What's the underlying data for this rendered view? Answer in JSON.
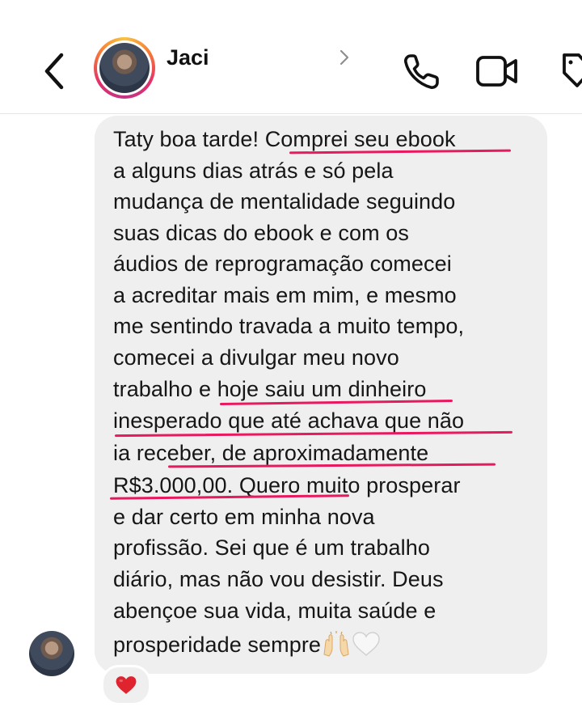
{
  "header": {
    "contact_name": "Jaci",
    "back_icon": "chevron-left-icon",
    "call_icon": "phone-icon",
    "video_icon": "video-camera-icon",
    "tag_icon": "tag-icon"
  },
  "message": {
    "lines": [
      "Taty boa tarde! Comprei seu ebook",
      "a alguns dias atrás e só pela",
      "mudança de mentalidade seguindo",
      "suas dicas do ebook e com os",
      "áudios de reprogramação comecei",
      "a acreditar mais em mim, e mesmo",
      "me sentindo travada a muito tempo,",
      "comecei a divulgar meu novo",
      "trabalho e hoje saiu um dinheiro",
      "inesperado que até achava que não",
      "ia receber, de aproximadamente",
      "R$3.000,00. Quero muito prosperar",
      "e dar certo em minha nova",
      "profissão. Sei que é um trabalho",
      "diário, mas não vou desistir. Deus",
      "abençoe sua vida, muita saúde e",
      "prosperidade sempre"
    ],
    "trailing_emojis": [
      "raising-hands-emoji",
      "white-heart-emoji"
    ],
    "highlight_color": "#e8195e",
    "bubble_color": "#efefef"
  },
  "reaction": {
    "emoji": "red-heart-emoji",
    "color": "#e0242f"
  }
}
